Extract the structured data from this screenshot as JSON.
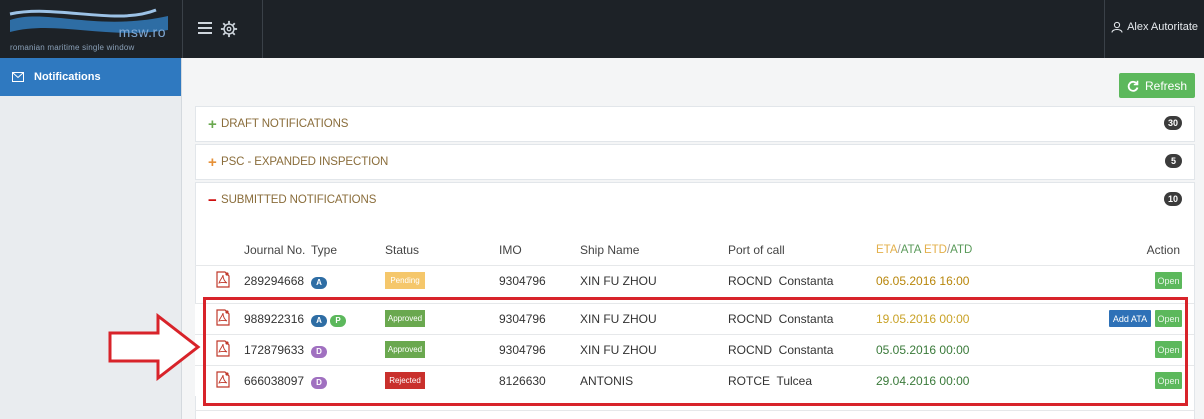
{
  "app": {
    "brand": "msw.ro",
    "tagline": "romanian maritime single window",
    "user": "Alex Autoritate"
  },
  "sidebar": {
    "items": [
      {
        "label": "Notifications",
        "icon": "envelope-icon"
      }
    ]
  },
  "toolbar": {
    "refresh_label": "Refresh"
  },
  "sections": [
    {
      "sign": "+",
      "label": "DRAFT NOTIFICATIONS",
      "count": "30",
      "color": "#6aa84f"
    },
    {
      "sign": "+",
      "label": "PSC - EXPANDED INSPECTION",
      "count": "5",
      "color": "#e69138"
    },
    {
      "sign": "−",
      "label": "SUBMITTED NOTIFICATIONS",
      "count": "10",
      "color": "#cc0000"
    }
  ],
  "table": {
    "headers": {
      "journal": "Journal No.",
      "type": "Type",
      "status": "Status",
      "imo": "IMO",
      "ship": "Ship Name",
      "port": "Port of call",
      "eta_a": "ETA",
      "ata": "ATA",
      "etd": "ETD",
      "atd": "ATD",
      "action": "Action"
    },
    "rows": [
      {
        "journal": "289294668",
        "types": [
          "A"
        ],
        "status": "Pending",
        "imo": "9304796",
        "ship": "XIN FU ZHOU",
        "port": "ROCND  Constanta",
        "eta": "06.05.2016 16:00",
        "eta_color": "#b8860b",
        "add_ata": "",
        "open": "Open"
      },
      {
        "journal": "988922316",
        "types": [
          "A",
          "P"
        ],
        "status": "Approved",
        "imo": "9304796",
        "ship": "XIN FU ZHOU",
        "port": "ROCND  Constanta",
        "eta": "19.05.2016 00:00",
        "eta_color": "#c9a227",
        "add_ata": "Add ATA",
        "open": "Open"
      },
      {
        "journal": "172879633",
        "types": [
          "D"
        ],
        "status": "Approved",
        "imo": "9304796",
        "ship": "XIN FU ZHOU",
        "port": "ROCND  Constanta",
        "eta": "05.05.2016 00:00",
        "eta_color": "#3a7a3a",
        "add_ata": "",
        "open": "Open"
      },
      {
        "journal": "666038097",
        "types": [
          "D"
        ],
        "status": "Rejected",
        "imo": "8126630",
        "ship": "ANTONIS",
        "port": "ROTCE  Tulcea",
        "eta": "29.04.2016 00:00",
        "eta_color": "#3a7a3a",
        "add_ata": "",
        "open": "Open"
      }
    ]
  },
  "colors": {
    "type_A": "#2e6da4",
    "type_P": "#5cb85c",
    "type_D": "#a070c0",
    "Pending": "#f5c76b",
    "Approved": "#6aa84f",
    "Rejected": "#c9302c"
  }
}
